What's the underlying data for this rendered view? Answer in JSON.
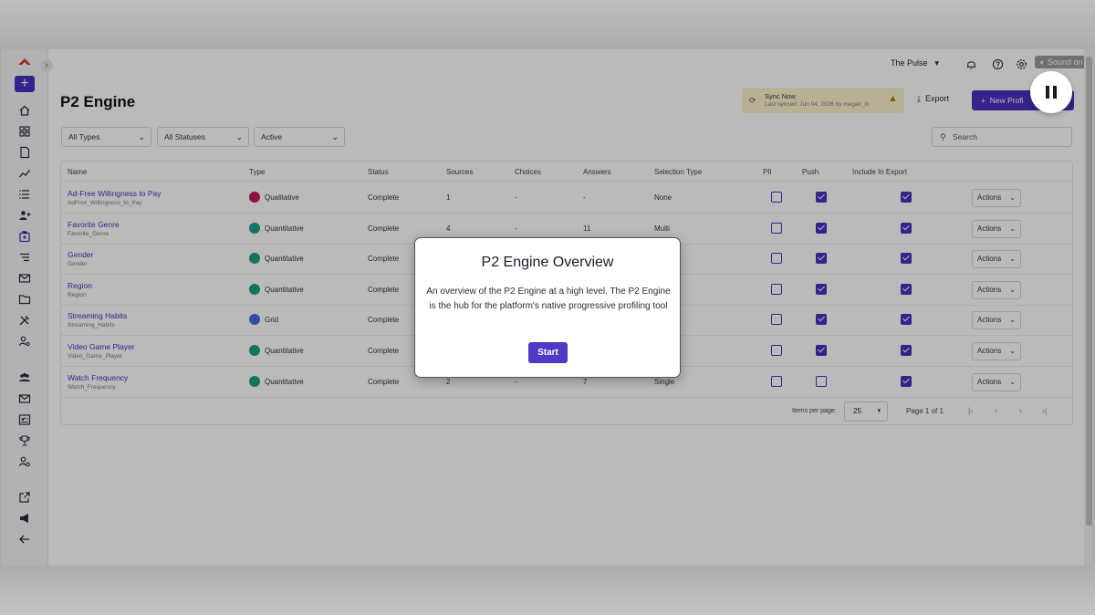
{
  "player": {
    "sound_label": "Sound on"
  },
  "header": {
    "org": "The Pulse",
    "page_title": "P2 Engine",
    "sync": {
      "title": "Sync Now",
      "subtitle": "Last synced: Jun 04, 2026 by megan_fc"
    },
    "export_label": "Export",
    "new_label": "New Profi"
  },
  "filters": {
    "type": "All Types",
    "status": "All Statuses",
    "active": "Active",
    "search_placeholder": "Search"
  },
  "table": {
    "columns": {
      "name": "Name",
      "type": "Type",
      "status": "Status",
      "sources": "Sources",
      "choices": "Choices",
      "answers": "Answers",
      "selection_type": "Selection Type",
      "pii": "PII",
      "push": "Push",
      "include_export": "Include In Export"
    },
    "action_label": "Actions",
    "rows": [
      {
        "name": "Ad-Free Willingness to Pay",
        "slug": "AdFree_Willingness_to_Pay",
        "type": "Qualitative",
        "status": "Complete",
        "sources": "1",
        "choices": "-",
        "answers": "-",
        "selection": "None",
        "pii": false,
        "push": true,
        "export": true
      },
      {
        "name": "Favorite Genre",
        "slug": "Favorite_Genre",
        "type": "Quantitative",
        "status": "Complete",
        "sources": "4",
        "choices": "-",
        "answers": "11",
        "selection": "Multi",
        "pii": false,
        "push": true,
        "export": true
      },
      {
        "name": "Gender",
        "slug": "Gender",
        "type": "Quantitative",
        "status": "Complete",
        "sources": "",
        "choices": "",
        "answers": "",
        "selection": "",
        "pii": false,
        "push": true,
        "export": true
      },
      {
        "name": "Region",
        "slug": "Region",
        "type": "Quantitative",
        "status": "Complete",
        "sources": "",
        "choices": "",
        "answers": "",
        "selection": "",
        "pii": false,
        "push": true,
        "export": true
      },
      {
        "name": "Streaming Habits",
        "slug": "Streaming_Habits",
        "type": "Grid",
        "status": "Complete",
        "sources": "",
        "choices": "",
        "answers": "",
        "selection": "",
        "pii": false,
        "push": true,
        "export": true
      },
      {
        "name": "Video Game Player",
        "slug": "Video_Game_Player",
        "type": "Quantitative",
        "status": "Complete",
        "sources": "",
        "choices": "",
        "answers": "",
        "selection": "",
        "pii": false,
        "push": true,
        "export": true
      },
      {
        "name": "Watch Frequency",
        "slug": "Watch_Frequency",
        "type": "Quantitative",
        "status": "Complete",
        "sources": "2",
        "choices": "-",
        "answers": "7",
        "selection": "Single",
        "pii": false,
        "push": false,
        "export": true
      }
    ]
  },
  "pagination": {
    "items_per_page_label": "Items per page:",
    "items_per_page": "25",
    "page_info": "Page 1 of 1"
  },
  "modal": {
    "title": "P2 Engine Overview",
    "body": "An overview of the P2 Engine at a high level. The P2 Engine is the hub for the platform's native progressive profiling tool",
    "start_label": "Start"
  },
  "colors": {
    "accent": "#4a2fbd",
    "qualitative": "#c2185b",
    "quantitative": "#1e9e8a",
    "grid": "#3f6fd8",
    "sync_bg": "#fdf1cc"
  },
  "icons": {
    "rail": [
      "home-icon",
      "dashboard-icon",
      "document-icon",
      "trending-icon",
      "list-icon",
      "add-user-icon",
      "p2-engine-icon",
      "lines-icon",
      "mail-icon",
      "folder-icon",
      "tools-icon",
      "user-search-icon",
      "people-icon",
      "mail-icon",
      "checklist-icon",
      "trophy-icon",
      "user-settings-icon",
      "external-link-icon",
      "megaphone-icon",
      "back-arrow-icon"
    ]
  }
}
